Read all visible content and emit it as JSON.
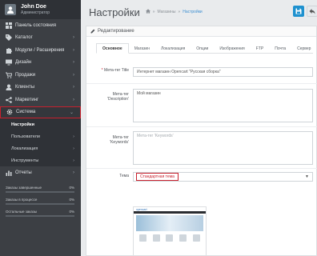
{
  "user": {
    "name": "John Doe",
    "role": "Администратор"
  },
  "sidebar": {
    "items": [
      {
        "label": "Панель состояния",
        "icon": "dashboard-icon",
        "chevron": ""
      },
      {
        "label": "Каталог",
        "icon": "tag-icon",
        "chevron": "›"
      },
      {
        "label": "Модули / Расширения",
        "icon": "puzzle-icon",
        "chevron": "›"
      },
      {
        "label": "Дизайн",
        "icon": "monitor-icon",
        "chevron": "›"
      },
      {
        "label": "Продажи",
        "icon": "cart-icon",
        "chevron": "›"
      },
      {
        "label": "Клиенты",
        "icon": "user-icon",
        "chevron": "›"
      },
      {
        "label": "Маркетинг",
        "icon": "share-icon",
        "chevron": "›"
      },
      {
        "label": "Система",
        "icon": "gear-icon",
        "chevron": "⌄"
      }
    ],
    "subitems": [
      {
        "label": "Настройки",
        "chevron": ""
      },
      {
        "label": "Пользователи",
        "chevron": "›"
      },
      {
        "label": "Локализация",
        "chevron": "›"
      },
      {
        "label": "Инструменты",
        "chevron": "›"
      }
    ],
    "reports": {
      "label": "Отчеты",
      "icon": "bar-chart-icon",
      "chevron": "›"
    },
    "stats": [
      {
        "label": "Заказы завершенные",
        "value": "0%"
      },
      {
        "label": "Заказы в процессе",
        "value": "0%"
      },
      {
        "label": "Остальные заказы",
        "value": "0%"
      }
    ]
  },
  "header": {
    "title": "Настройки",
    "breadcrumbs": [
      "Магазины",
      "Настройки"
    ],
    "separator": "»"
  },
  "panel": {
    "title": "Редактирование",
    "tabs": [
      "Основное",
      "Магазин",
      "Локализация",
      "Опции",
      "Изображения",
      "FTP",
      "Почта",
      "Сервер"
    ],
    "active_tab": "Основное"
  },
  "form": {
    "meta_title": {
      "label": "Мета-тег Title",
      "value": "Интернет магазин Opencart \"Русская сборка\""
    },
    "meta_description": {
      "label": "Мета-тег 'Description'",
      "value": "Мой магазин"
    },
    "meta_keywords": {
      "label": "Мета-тег 'Keywords'",
      "placeholder": "Мета-тег 'Keywords'"
    },
    "theme": {
      "label": "Тема",
      "value": "Стандартная тема"
    }
  },
  "preview": {
    "brand": "opencart",
    "caption": ""
  },
  "colors": {
    "sidebar": "#3c3f44",
    "accent": "#1e91cf",
    "highlight": "#c8202d"
  }
}
